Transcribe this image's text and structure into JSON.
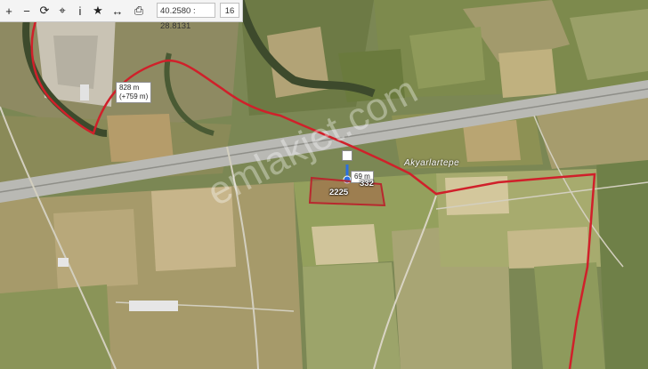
{
  "toolbar": {
    "buttons": [
      {
        "name": "zoom-in",
        "glyph": "+"
      },
      {
        "name": "zoom-out",
        "glyph": "−"
      },
      {
        "name": "refresh",
        "glyph": "⟳"
      },
      {
        "name": "locate",
        "glyph": "⌖"
      },
      {
        "name": "info",
        "glyph": "i"
      },
      {
        "name": "favorite",
        "glyph": "★"
      },
      {
        "name": "measure",
        "glyph": "↔"
      },
      {
        "name": "print",
        "glyph": "⎙"
      }
    ],
    "coordinates": "40.2580 : 28.8131",
    "zoom_level": "16"
  },
  "map": {
    "measure_label_1_line1": "828 m",
    "measure_label_1_line2": "(+759 m)",
    "measure_label_2": "69 m",
    "plot_number": "2225",
    "parcel_number": "332",
    "place_name": "Akyarlartepe",
    "watermark": "emlakjet.com"
  },
  "colors": {
    "boundary": "#d0202a",
    "parcel_fill": "#b8282e",
    "measure": "#2a6fe0",
    "road": "#b9b9b4"
  }
}
